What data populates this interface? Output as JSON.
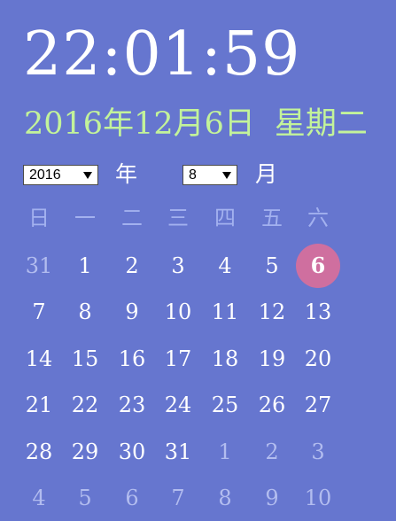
{
  "clock": {
    "time": "22:01:59"
  },
  "date_line": {
    "date": "2016年12月6日",
    "weekday": "星期二"
  },
  "selectors": {
    "year_value": "2016",
    "year_unit": "年",
    "month_value": "8",
    "month_unit": "月"
  },
  "calendar": {
    "weekdays": [
      "日",
      "一",
      "二",
      "三",
      "四",
      "五",
      "六"
    ],
    "weeks": [
      [
        {
          "d": "31",
          "other": true
        },
        {
          "d": "1"
        },
        {
          "d": "2"
        },
        {
          "d": "3"
        },
        {
          "d": "4"
        },
        {
          "d": "5"
        },
        {
          "d": "6",
          "today": true
        }
      ],
      [
        {
          "d": "7"
        },
        {
          "d": "8"
        },
        {
          "d": "9"
        },
        {
          "d": "10"
        },
        {
          "d": "11"
        },
        {
          "d": "12"
        },
        {
          "d": "13"
        }
      ],
      [
        {
          "d": "14"
        },
        {
          "d": "15"
        },
        {
          "d": "16"
        },
        {
          "d": "17"
        },
        {
          "d": "18"
        },
        {
          "d": "19"
        },
        {
          "d": "20"
        }
      ],
      [
        {
          "d": "21"
        },
        {
          "d": "22"
        },
        {
          "d": "23"
        },
        {
          "d": "24"
        },
        {
          "d": "25"
        },
        {
          "d": "26"
        },
        {
          "d": "27"
        }
      ],
      [
        {
          "d": "28"
        },
        {
          "d": "29"
        },
        {
          "d": "30"
        },
        {
          "d": "31"
        },
        {
          "d": "1",
          "other": true
        },
        {
          "d": "2",
          "other": true
        },
        {
          "d": "3",
          "other": true
        }
      ],
      [
        {
          "d": "4",
          "other": true
        },
        {
          "d": "5",
          "other": true
        },
        {
          "d": "6",
          "other": true
        },
        {
          "d": "7",
          "other": true
        },
        {
          "d": "8",
          "other": true
        },
        {
          "d": "9",
          "other": true
        },
        {
          "d": "10",
          "other": true
        }
      ]
    ]
  },
  "colors": {
    "background": "#6676cf",
    "date_text": "#c3f39a",
    "weekday_header": "#a3b1ef",
    "other_month_day": "#b2bcef",
    "today_highlight": "#cf6f9f"
  }
}
